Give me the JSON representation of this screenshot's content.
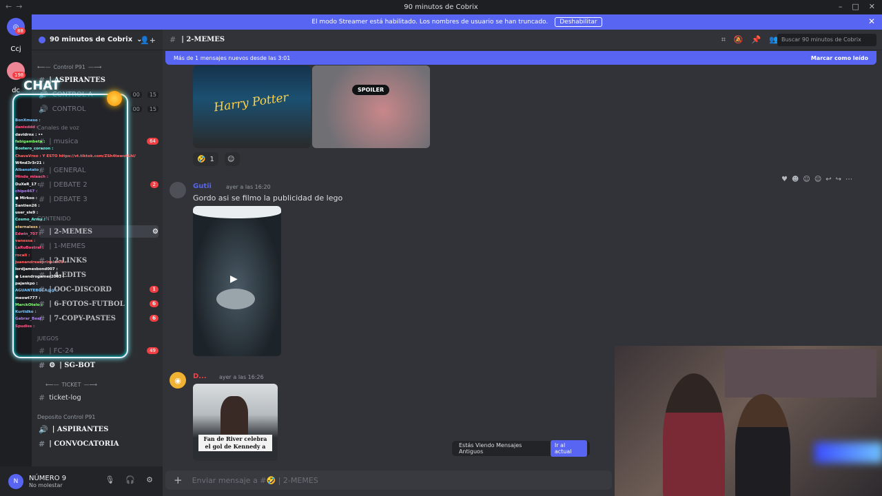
{
  "window": {
    "title": "90 minutos de Cobrix"
  },
  "banner": {
    "text": "El modo Streamer está habilitado. Los nombres de usuario se han truncado.",
    "button": "Deshabilitar"
  },
  "servers": [
    {
      "label": "Ccj"
    },
    {
      "label": "dc"
    }
  ],
  "server_badges": {
    "home": "88",
    "second": "198"
  },
  "sidebar": {
    "server_name": "90 minutos de Cobrix",
    "categories": {
      "control": "Control P91",
      "canales": "Canales de voz",
      "juegos": "JUEGOS",
      "ticket": "TICKET",
      "deposito": "Deposito Control P91",
      "contenido": "CONTENIDO"
    },
    "channels": [
      {
        "name": "| ASPIRANTES"
      },
      {
        "name": "CONTROL A",
        "num1": "00",
        "num2": "15"
      },
      {
        "name": "CONTROL",
        "num1": "00",
        "num2": "15"
      },
      {
        "name": "| musica",
        "count": "64"
      },
      {
        "name": "| GENERAL"
      },
      {
        "name": "| DEBATE 2",
        "count": "2"
      },
      {
        "name": "| DEBATE 3"
      },
      {
        "name": "| 2-MEMES"
      },
      {
        "name": "| 1-MEMES"
      },
      {
        "name": "| 2-LINKS"
      },
      {
        "name": "| 4-EDITS"
      },
      {
        "name": "| OOC-DISCORD",
        "count": "1"
      },
      {
        "name": "| 6-FOTOS-FUTBOL",
        "count": "6"
      },
      {
        "name": "| 7-COPY-PASTES",
        "count": "6"
      },
      {
        "name": "| FC-24",
        "count": "49"
      },
      {
        "name": "| SG-BOT"
      },
      {
        "name": "ticket-log"
      },
      {
        "name": "| ASPIRANTES"
      },
      {
        "name": "| CONVOCATORIA"
      }
    ]
  },
  "user": {
    "name": "NÚMERO 9",
    "status": "No molestar"
  },
  "channel": {
    "title": "| 2-MEMES",
    "search_placeholder": "Buscar 90 minutos de Cobrix"
  },
  "new_messages": {
    "text": "Más de 1 mensajes nuevos desde las 3:01",
    "mark_read": "Marcar como leído"
  },
  "messages": [
    {
      "spoiler_label": "SPOILER",
      "poster_text": "Harry Potter",
      "reaction_count": "1"
    },
    {
      "author": "Gutii",
      "time": "ayer a las 16:20",
      "text": "Gordo asi se filmo la publicidad de lego"
    },
    {
      "author": "D...",
      "time": "ayer a las 16:26",
      "caption_line1": "Fan de River celebra",
      "caption_line2": "el gol de Kennedy a"
    }
  ],
  "old_messages": {
    "text": "Estás Viendo Mensajes Antiguos",
    "button": "Ir al actual"
  },
  "composer": {
    "placeholder": "Enviar mensaje a #🤣 | 2-MEMES"
  },
  "overlay": {
    "title": "CHAT",
    "lines": [
      {
        "name": "BonXmeso :",
        "color": "#7ec8ff"
      },
      {
        "name": "danixddd :",
        "color": "#ff5c8a"
      },
      {
        "name": "davidrnx : ••",
        "color": "#ffffff"
      },
      {
        "name": "fabigambeta :",
        "color": "#8cff7e"
      },
      {
        "name": "Bostero_corazon :",
        "color": "#7efff2"
      },
      {
        "name": "ChavaVroo : Y ESTO https://vt.tiktok.com/ZSh4tews6Lhl/",
        "color": "#ff6b6b"
      },
      {
        "name": "W4nd3r3r21 :",
        "color": "#ffffff"
      },
      {
        "name": "Albanotato :",
        "color": "#7ec8ff"
      },
      {
        "name": "Minda_miaach :",
        "color": "#ff5c8a"
      },
      {
        "name": "DuXeR_17 :",
        "color": "#ffffff"
      },
      {
        "name": "chipo467 :",
        "color": "#b57eff"
      },
      {
        "name": "● Mirkoo :",
        "color": "#ffffff"
      },
      {
        "name": "Santien26 :",
        "color": "#ffffff"
      },
      {
        "name": "user_sle9 :",
        "color": "#ffffff"
      },
      {
        "name": "Cosmo_Army :",
        "color": "#7efff2"
      },
      {
        "name": "eternaless :",
        "color": "#ffcf7e"
      },
      {
        "name": "Edwin_707 :",
        "color": "#ff5c8a"
      },
      {
        "name": "vanessa :",
        "color": "#ff6b6b"
      },
      {
        "name": "LaRuBostral :",
        "color": "#ff5c8a"
      },
      {
        "name": "rocali :",
        "color": "#ff6b6b"
      },
      {
        "name": "juanandreasprinaldi06 :",
        "color": "#ff6b6b"
      },
      {
        "name": "lordjamesbond007 :",
        "color": "#ffffff"
      },
      {
        "name": "● Leandrogamer2003 :",
        "color": "#ffffff"
      },
      {
        "name": "pajankpo :",
        "color": "#ffffff"
      },
      {
        "name": "AGUANTEBOCA@@ :",
        "color": "#7ec8ff"
      },
      {
        "name": "meowt777 :",
        "color": "#ffffff"
      },
      {
        "name": "MarckOtelo :",
        "color": "#8cff7e"
      },
      {
        "name": "Kurtidko :",
        "color": "#7ec8ff"
      },
      {
        "name": "Gabrar_Bear :",
        "color": "#b57eff"
      },
      {
        "name": "Spudiss :",
        "color": "#ff5c8a"
      }
    ]
  },
  "colors": {
    "accent": "#5865f2",
    "sidebar": "#2b2d31",
    "chat": "#313338",
    "danger": "#f23f43"
  }
}
